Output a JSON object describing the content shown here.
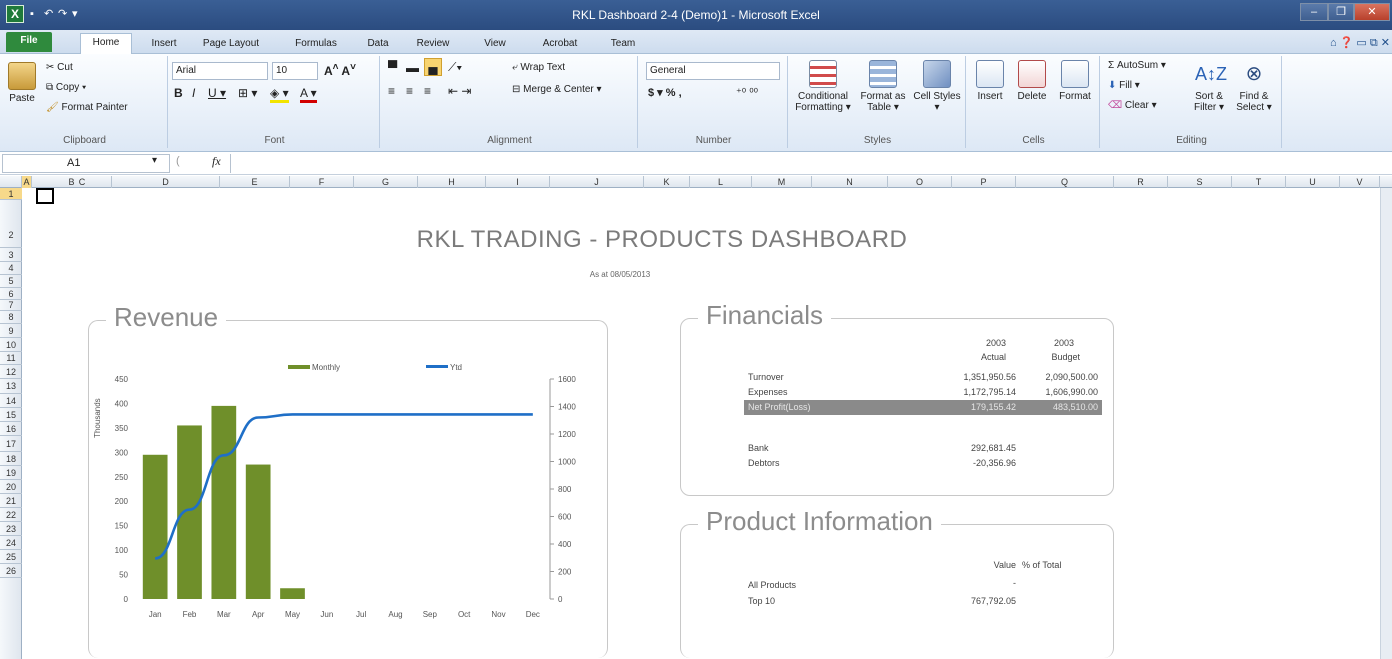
{
  "window": {
    "title": "RKL Dashboard 2-4 (Demo)1  -  Microsoft Excel",
    "app_icon": "X"
  },
  "tabs": [
    "File",
    "Home",
    "Insert",
    "Page Layout",
    "Formulas",
    "Data",
    "Review",
    "View",
    "Acrobat",
    "Team"
  ],
  "ribbon": {
    "clipboard": {
      "paste": "Paste",
      "cut": "Cut",
      "copy": "Copy ▾",
      "format_painter": "Format Painter",
      "label": "Clipboard"
    },
    "font": {
      "name": "Arial",
      "size": "10",
      "label": "Font"
    },
    "alignment": {
      "wrap": "Wrap Text",
      "merge": "Merge & Center ▾",
      "label": "Alignment"
    },
    "number": {
      "format": "General",
      "label": "Number",
      "currency": "$ ▾ % ,",
      "decimals": "⁺⁰ ⁰⁰"
    },
    "styles": {
      "conditional": "Conditional Formatting ▾",
      "format_table": "Format as Table ▾",
      "cell_styles": "Cell Styles ▾",
      "label": "Styles"
    },
    "cells": {
      "insert": "Insert",
      "delete": "Delete",
      "format": "Format",
      "label": "Cells"
    },
    "editing": {
      "autosum": "Σ AutoSum ▾",
      "fill": "Fill ▾",
      "clear": "Clear ▾",
      "sort": "Sort & Filter ▾",
      "find": "Find & Select ▾",
      "label": "Editing"
    }
  },
  "formula_bar": {
    "name_box": "A1",
    "fx": "fx",
    "value": ""
  },
  "columns": [
    "A",
    "B",
    "C",
    "D",
    "E",
    "F",
    "G",
    "H",
    "I",
    "J",
    "K",
    "L",
    "M",
    "N",
    "O",
    "P",
    "Q",
    "R",
    "S",
    "T",
    "U",
    "V"
  ],
  "rows": [
    "1",
    "2",
    "3",
    "4",
    "5",
    "6",
    "7",
    "8",
    "9",
    "10",
    "11",
    "12",
    "13",
    "14",
    "15",
    "16",
    "17",
    "18",
    "19",
    "20",
    "21",
    "22",
    "23",
    "24",
    "25",
    "26"
  ],
  "dashboard": {
    "title": "RKL TRADING  - PRODUCTS DASHBOARD",
    "subtitle": "As at 08/05/2013"
  },
  "revenue": {
    "title": "Revenue"
  },
  "chart_data": {
    "type": "bar",
    "categories": [
      "Jan",
      "Feb",
      "Mar",
      "Apr",
      "May",
      "Jun",
      "Jul",
      "Aug",
      "Sep",
      "Oct",
      "Nov",
      "Dec"
    ],
    "series": [
      {
        "name": "Monthly",
        "type": "bar",
        "axis": "left",
        "values": [
          295,
          355,
          395,
          275,
          22,
          0,
          0,
          0,
          0,
          0,
          0,
          0
        ],
        "color": "#6f8f2a"
      },
      {
        "name": "Ytd",
        "type": "line",
        "axis": "right",
        "values": [
          295,
          650,
          1045,
          1320,
          1342,
          1342,
          1342,
          1342,
          1342,
          1342,
          1342,
          1342
        ],
        "color": "#1f6fc7"
      }
    ],
    "ylabel": "Thousands",
    "ylim": [
      0,
      450
    ],
    "yticks": [
      "0",
      "50",
      "100",
      "150",
      "200",
      "250",
      "300",
      "350",
      "400",
      "450"
    ],
    "y2lim": [
      0,
      1600
    ],
    "y2ticks": [
      "0",
      "200",
      "400",
      "600",
      "800",
      "1000",
      "1200",
      "1400",
      "1600"
    ],
    "legend_position": "top"
  },
  "financials": {
    "title": "Financials",
    "col1_year": "2003",
    "col1_label": "Actual",
    "col2_year": "2003",
    "col2_label": "Budget",
    "rows": [
      {
        "label": "Turnover",
        "actual": "1,351,950.56",
        "budget": "2,090,500.00"
      },
      {
        "label": "Expenses",
        "actual": "1,172,795.14",
        "budget": "1,606,990.00"
      },
      {
        "label": "Net Profit(Loss)",
        "actual": "179,155.42",
        "budget": "483,510.00"
      },
      {
        "label": "Bank",
        "actual": "292,681.45",
        "budget": ""
      },
      {
        "label": "Debtors",
        "actual": "-20,356.96",
        "budget": ""
      }
    ]
  },
  "product_info": {
    "title": "Product Information",
    "value_header": "Value",
    "pct_header": "% of Total",
    "rows": [
      {
        "label": "All Products",
        "value": "-"
      },
      {
        "label": "Top 10",
        "value": "767,792.05"
      }
    ]
  }
}
